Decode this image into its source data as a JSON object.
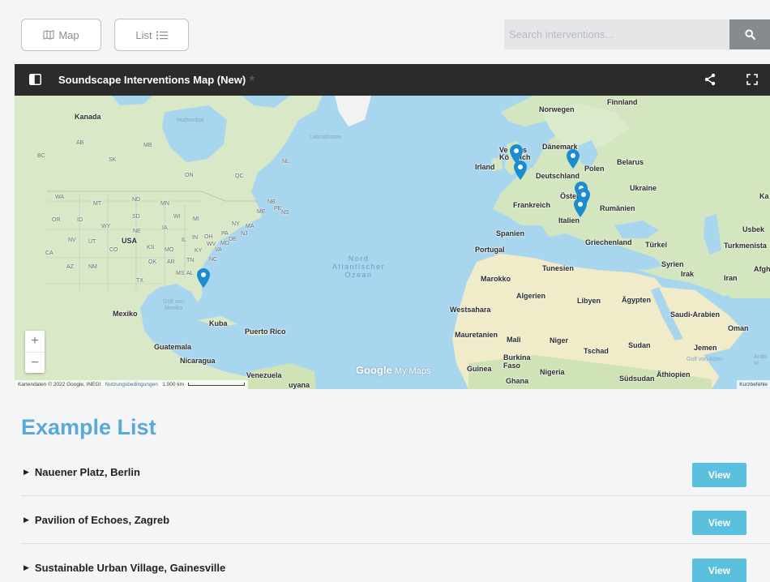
{
  "toolbar": {
    "map_label": "Map",
    "list_label": "List"
  },
  "search": {
    "placeholder": "Search interventions...",
    "value": ""
  },
  "map": {
    "title": "Soundscape Interventions Map (New)",
    "labels": {
      "kanada": "Kanada",
      "hudsonbai": "Hudsonbai",
      "labradorsee": "Labradorsee",
      "usa": "USA",
      "mexiko": "Mexiko",
      "golf": "Golf von\nMexiko",
      "kuba": "Kuba",
      "puerto_rico": "Puerto Rico",
      "guatemala": "Guatemala",
      "nicaragua": "Nicaragua",
      "venezuela": "Venezuela",
      "guyana": "uyana",
      "nord_atlantischer": "Nord\nAtlantischer\nOzean",
      "norwegen": "Norwegen",
      "finnland": "Finnland",
      "irland": "Irland",
      "vk": "Ve  gtes\nKö  reich",
      "daenemark": "Dänemark",
      "deutschland": "Deutschland",
      "polen": "Polen",
      "belarus": "Belarus",
      "ukraine": "Ukraine",
      "frankreich": "Frankreich",
      "oesterreich": "Öster  h",
      "rumaenien": "Rumänien",
      "italien": "Italien",
      "spanien": "Spanien",
      "portugal": "Portugal",
      "griechenland": "Griechenland",
      "tuerkei": "Türkei",
      "turkmenistan": "Turkmenista",
      "usbek": "Usbek",
      "ka": "Ka",
      "syrien": "Syrien",
      "irak": "Irak",
      "iran": "Iran",
      "afgha": "Afgha",
      "tunesien": "Tunesien",
      "marokko": "Marokko",
      "algerien": "Algerien",
      "libyen": "Libyen",
      "aegypten": "Ägypten",
      "westsahara": "Westsahara",
      "saudi": "Saudi-Arabien",
      "oman": "Oman",
      "mauretanien": "Mauretanien",
      "mali": "Mali",
      "niger": "Niger",
      "tschad": "Tschad",
      "sudan": "Sudan",
      "jemen": "Jemen",
      "golf_aden": "Golf von Aden",
      "arabi": "Arabi\nM",
      "burkina": "Burkina\nFaso",
      "guinea": "Guinea",
      "nigeria": "Nigeria",
      "ghana": "Ghana",
      "suedsudan": "Südsudan",
      "aethiopien": "Äthiopien",
      "ab": "AB",
      "sk": "SK",
      "mb": "MB",
      "bc": "BC",
      "on": "ON",
      "qc": "QC",
      "nl": "NL",
      "wa": "WA",
      "mt": "MT",
      "nd": "ND",
      "mn": "MN",
      "or": "OR",
      "id": "ID",
      "wy": "WY",
      "sd": "SD",
      "wi": "WI",
      "mi": "MI",
      "ne": "NE",
      "ia": "IA",
      "nv": "NV",
      "ut": "UT",
      "co": "CO",
      "ks": "KS",
      "mo": "MO",
      "il": "IL",
      "in": "IN",
      "oh": "OH",
      "pa": "PA",
      "ny": "NY",
      "ca": "CA",
      "ok": "OK",
      "ar": "AR",
      "tn": "TN",
      "az": "AZ",
      "nm": "NM",
      "tx": "TX",
      "ms": "MS",
      "al": "AL",
      "ga": "GA",
      "nc": "NC",
      "ky": "KY",
      "va": "VA",
      "wv": "WV",
      "md": "MD",
      "de": "DE",
      "nj": "NJ",
      "ma": "MA",
      "me": "ME",
      "nb": "NB",
      "ns": "NS",
      "pe": "PE"
    },
    "attribution": "Kartendaten © 2022 Google, INEGI",
    "terms": "Nutzungsbedingungen",
    "scale": "1.000 km",
    "shortcuts": "Kurzbefehle",
    "logo_google": "Google",
    "logo_mymaps": " My Maps",
    "zoom_in": "+",
    "zoom_out": "−",
    "pin_color": "#1a8ccf"
  },
  "list": {
    "title": "Example List",
    "items": [
      {
        "label": "Nauener Platz, Berlin",
        "action": "View"
      },
      {
        "label": "Pavilion of Echoes, Zagreb",
        "action": "View"
      },
      {
        "label": "Sustainable Urban Village, Gainesville",
        "action": "View"
      }
    ]
  },
  "colors": {
    "accent": "#5aa9d6",
    "view_button": "#5bc0de",
    "header_bg": "#2b2b2b",
    "water": "#a9d6ef",
    "land": "#d4e6c3"
  }
}
